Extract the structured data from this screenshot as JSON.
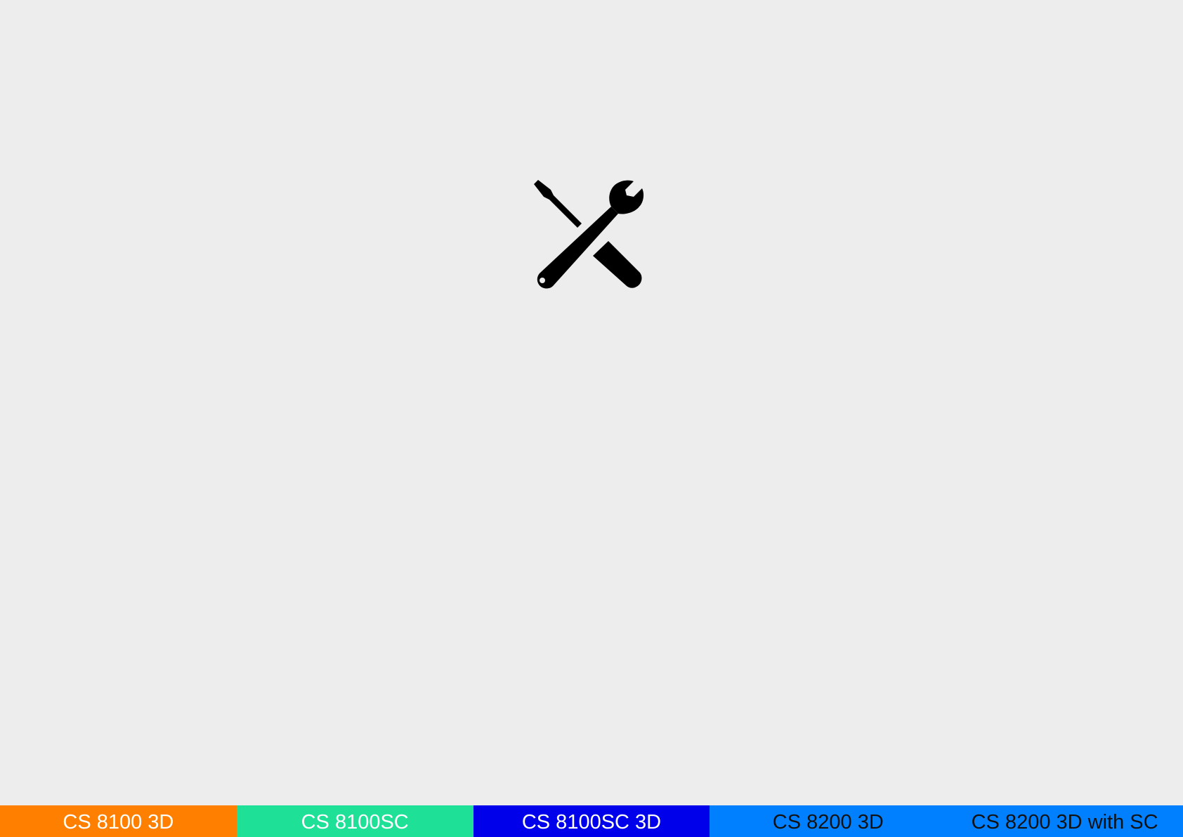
{
  "main": {
    "icon": "tools-icon"
  },
  "model_bar": {
    "items": [
      {
        "label": "CS 8100 3D",
        "bg": "#ff8000",
        "fg": "#ffffff"
      },
      {
        "label": "CS 8100SC",
        "bg": "#1ee096",
        "fg": "#ffffff"
      },
      {
        "label": "CS 8100SC 3D",
        "bg": "#0000eb",
        "fg": "#ffffff"
      },
      {
        "label": "CS 8200 3D",
        "bg": "#0080ff",
        "fg": "#111111"
      },
      {
        "label": "CS 8200 3D with SC",
        "bg": "#0080ff",
        "fg": "#111111"
      }
    ]
  }
}
